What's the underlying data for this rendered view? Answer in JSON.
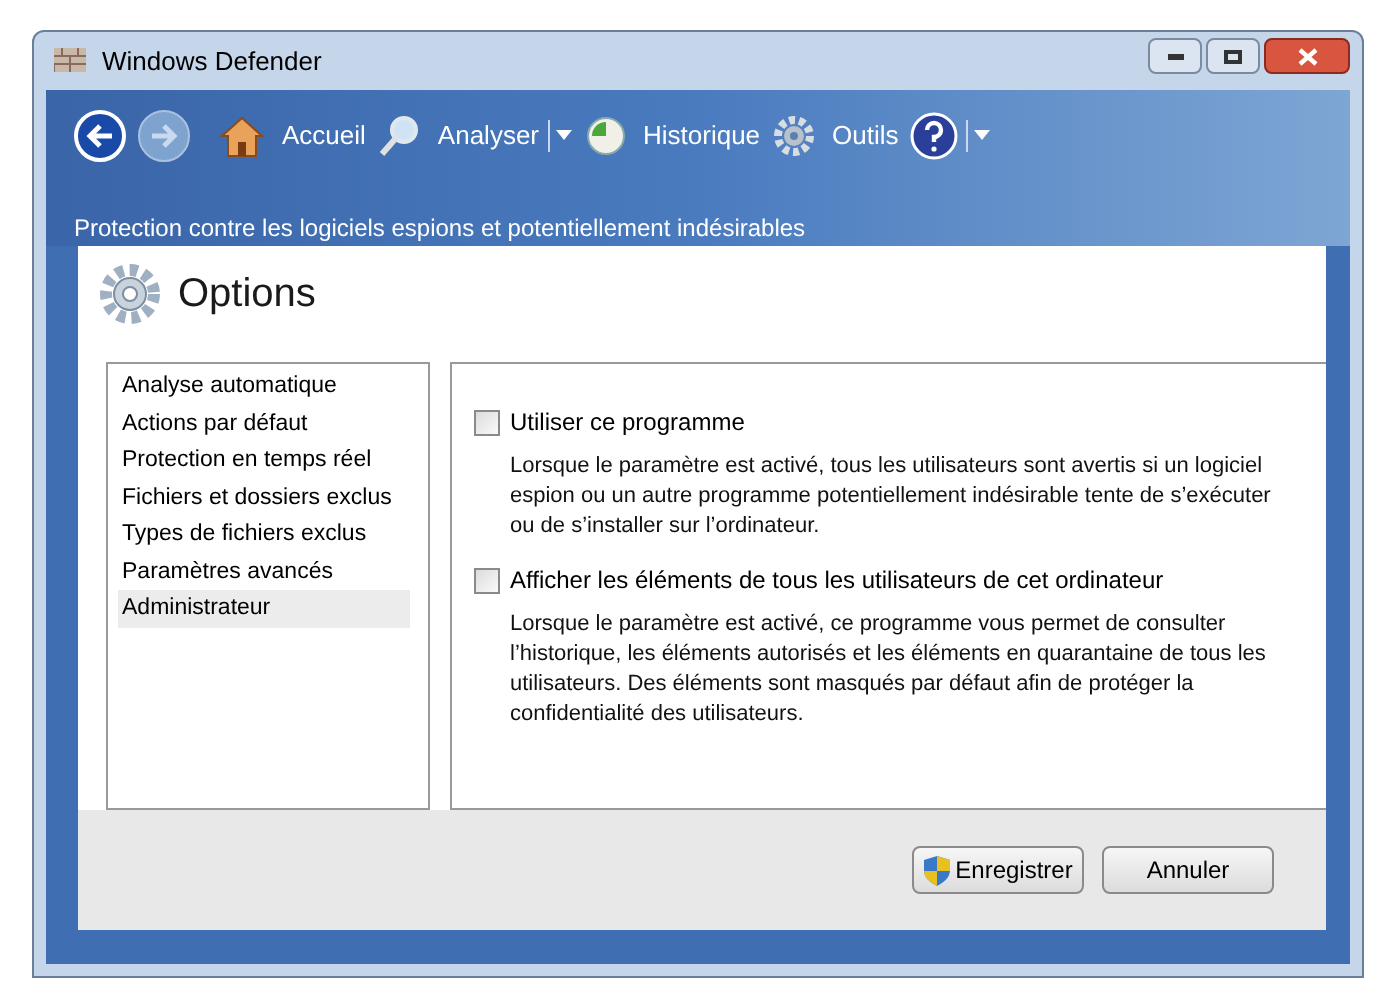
{
  "window": {
    "title": "Windows Defender"
  },
  "toolbar": [
    {
      "label": "Accueil",
      "dropdown": false
    },
    {
      "label": "Analyser",
      "dropdown": true
    },
    {
      "label": "Historique",
      "dropdown": false
    },
    {
      "label": "Outils",
      "dropdown": false
    },
    {
      "dropdown": true
    }
  ],
  "subtitle": "Protection contre les logiciels espions et potentiellement indésirables",
  "page_title": "Options",
  "sidebar": [
    {
      "label": "Analyse automatique",
      "selected": false
    },
    {
      "label": "Actions par défaut",
      "selected": false
    },
    {
      "label": "Protection en temps réel",
      "selected": false
    },
    {
      "label": "Fichiers et dossiers exclus",
      "selected": false
    },
    {
      "label": "Types de fichiers exclus",
      "selected": false
    },
    {
      "label": "Paramètres avancés",
      "selected": false
    },
    {
      "label": "Administrateur",
      "selected": true
    }
  ],
  "settings": [
    {
      "label": "Utiliser ce programme",
      "checked": false,
      "description": "Lorsque le paramètre est activé, tous les utilisateurs sont avertis si un logiciel espion ou un autre programme potentiellement indésirable tente de s’exécuter ou de s’installer sur l’ordinateur."
    },
    {
      "label": "Afficher les éléments de tous les utilisateurs de cet ordinateur",
      "checked": false,
      "description": "Lorsque le paramètre est activé, ce programme vous permet de consulter l’historique, les éléments autorisés et les éléments en quarantaine de tous les utilisateurs. Des éléments sont masqués par défaut afin de protéger la confidentialité des utilisateurs."
    }
  ],
  "buttons": [
    {
      "label": "Enregistrer",
      "kind": "shield"
    },
    {
      "label": "Annuler",
      "kind": "plain"
    }
  ]
}
